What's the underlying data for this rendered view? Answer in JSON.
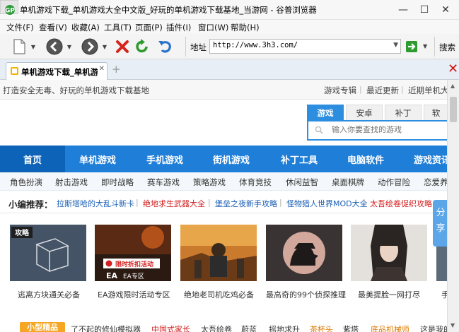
{
  "window": {
    "title": "单机游戏下载_单机游戏大全中文版_好玩的单机游戏下载基地_当游网 - 谷普浏览器",
    "minimize": "—",
    "maximize": "☐",
    "close": "✕"
  },
  "menu": [
    "文件(F)",
    "查看(V)",
    "收藏(A)",
    "工具(T)",
    "页面(P)",
    "插件(I)",
    "窗口(W)",
    "帮助(H)"
  ],
  "toolbar": {
    "address_label": "地址",
    "address_value": "http://www.3h3.com/",
    "search_label": "搜索",
    "icons": [
      "new-page-icon",
      "back-icon",
      "forward-icon",
      "stop-icon",
      "refresh-icon",
      "undo-icon",
      "go-icon"
    ]
  },
  "tabs": {
    "active_label": "单机游戏下载_单机游戏",
    "close": "✕",
    "new_tab": "+",
    "close_all": "✕"
  },
  "site": {
    "slogan": "打造安全无毒、好玩的单机游戏下载基地",
    "top_links": [
      "游戏专辑",
      "最近更新",
      "近期单机大作"
    ],
    "search_tabs": [
      "游戏",
      "安卓",
      "补丁",
      "软"
    ],
    "search_placeholder": "输入你要查找的游戏",
    "nav": [
      "首页",
      "单机游戏",
      "手机游戏",
      "街机游戏",
      "补丁工具",
      "电脑软件",
      "游戏资讯"
    ],
    "subnav": [
      "角色扮演",
      "射击游戏",
      "即时战略",
      "赛车游戏",
      "策略游戏",
      "体育竞技",
      "休闲益智",
      "桌面棋牌",
      "动作冒险",
      "恋爱养成"
    ],
    "recommend_label": "小编推荐：",
    "recommend_links": [
      {
        "text": "拉斯塔哈的大乱斗新卡",
        "color": "#1a5fb4"
      },
      {
        "text": "绝地求生武器大全",
        "color": "#d21f1f"
      },
      {
        "text": "堡垒之夜新手攻略",
        "color": "#1a5fb4"
      },
      {
        "text": "怪物猎人世界MOD大全",
        "color": "#1a5fb4"
      },
      {
        "text": "太吾绘卷促织攻略",
        "color": "#d21f1f"
      }
    ],
    "thumbs": [
      {
        "caption": "逃离方块通关必备",
        "badge": "攻略"
      },
      {
        "caption": "EA游戏限时活动专区",
        "overlay1": "限时折扣活动",
        "overlay2": "EA专区",
        "brand": "EA"
      },
      {
        "caption": "绝地老司机吃鸡必备"
      },
      {
        "caption": "最高奇的99个侦探推理"
      },
      {
        "caption": "最美提脸一网打尽"
      },
      {
        "caption": "手"
      }
    ],
    "share_tab": "分享",
    "bottom_label": "小型精品",
    "bottom_links": [
      {
        "text": "了不起的修仙模拟器",
        "color": "#333333"
      },
      {
        "text": "中国式家长",
        "color": "#d21f1f"
      },
      {
        "text": "太吾绘卷",
        "color": "#333333"
      },
      {
        "text": "蔚蓝",
        "color": "#333333"
      },
      {
        "text": "摇地求升",
        "color": "#333333"
      },
      {
        "text": "茶杯头",
        "color": "#e07b00"
      },
      {
        "text": "紫塔",
        "color": "#333333"
      },
      {
        "text": "底品机械师",
        "color": "#e07b00"
      },
      {
        "text": "这是我的",
        "color": "#333333"
      }
    ]
  },
  "colors": {
    "nav_blue": "#1f7ed7",
    "nav_home": "#0d63b7",
    "accent_red": "#d21f1f",
    "share_blue": "#5ba6e8"
  }
}
